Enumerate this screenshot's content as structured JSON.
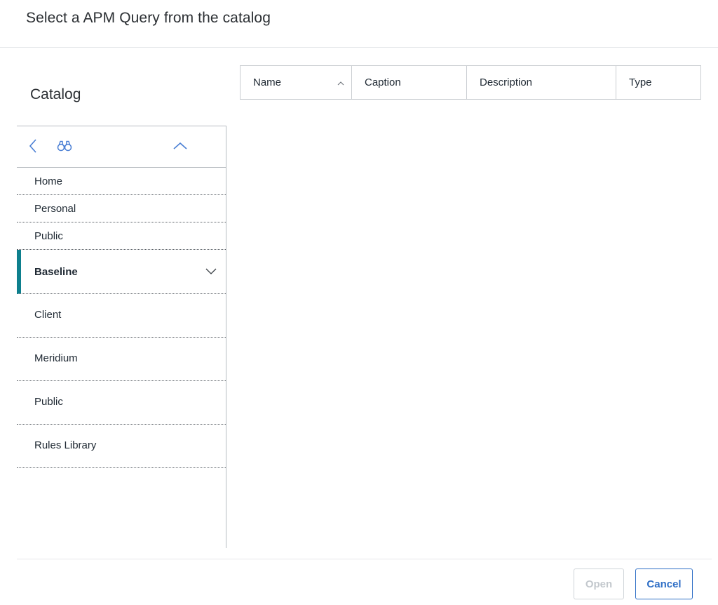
{
  "dialog": {
    "title": "Select a APM Query from the catalog"
  },
  "catalog": {
    "title": "Catalog",
    "toolbar": {
      "back_icon": "chevron-left-icon",
      "find_icon": "binoculars-icon",
      "collapse_icon": "chevron-up-icon"
    },
    "top_items": [
      {
        "label": "Home"
      },
      {
        "label": "Personal"
      },
      {
        "label": "Public"
      }
    ],
    "selected_item": {
      "label": "Baseline",
      "icon": "chevron-down-icon"
    },
    "child_items": [
      {
        "label": "Client"
      },
      {
        "label": "Meridium"
      },
      {
        "label": "Public"
      },
      {
        "label": "Rules Library"
      }
    ]
  },
  "grid": {
    "columns": [
      {
        "label": "Name",
        "sort_icon": "sort-ascending-icon"
      },
      {
        "label": "Caption"
      },
      {
        "label": "Description"
      },
      {
        "label": "Type"
      }
    ]
  },
  "footer": {
    "open_label": "Open",
    "cancel_label": "Cancel"
  },
  "colors": {
    "accent": "#0d7f8d",
    "primary_link": "#2f6fc6",
    "icon_blue": "#4a7fd4"
  }
}
